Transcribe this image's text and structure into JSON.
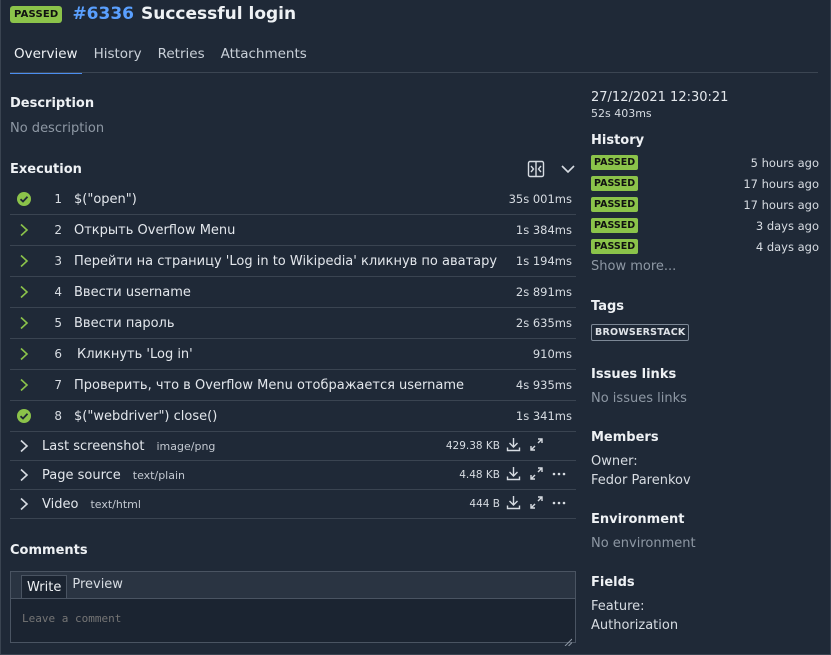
{
  "header": {
    "status": "PASSED",
    "test_number": "#6336",
    "title": "Successful login"
  },
  "tabs": [
    {
      "label": "Overview",
      "active": true
    },
    {
      "label": "History"
    },
    {
      "label": "Retries"
    },
    {
      "label": "Attachments"
    }
  ],
  "description": {
    "title": "Description",
    "value": "No description"
  },
  "execution": {
    "title": "Execution",
    "steps": [
      {
        "status": "passed",
        "num": "1",
        "name": "$(\"open\")",
        "duration": "35s 001ms"
      },
      {
        "status": "expand",
        "num": "2",
        "name": "Открыть Overflow Menu",
        "duration": "1s 384ms"
      },
      {
        "status": "expand",
        "num": "3",
        "name": "Перейти на страницу 'Log in to Wikipedia' кликнув по аватару",
        "duration": "1s 194ms"
      },
      {
        "status": "expand",
        "num": "4",
        "name": "Ввести username",
        "duration": "2s 891ms"
      },
      {
        "status": "expand",
        "num": "5",
        "name": "Ввести пароль",
        "duration": "2s 635ms"
      },
      {
        "status": "expand",
        "num": "6",
        "name": "Кликнуть 'Log in'",
        "duration": "910ms"
      },
      {
        "status": "expand",
        "num": "7",
        "name": "Проверить, что в Overflow Menu отображается username",
        "duration": "4s 935ms"
      },
      {
        "status": "passed",
        "num": "8",
        "name": "$(\"webdriver\") close()",
        "duration": "1s 341ms"
      }
    ],
    "attachments": [
      {
        "name": "Last screenshot",
        "type": "image/png",
        "size": "429.38 KB",
        "has_menu": false
      },
      {
        "name": "Page source",
        "type": "text/plain",
        "size": "4.48 KB",
        "has_menu": true
      },
      {
        "name": "Video",
        "type": "text/html",
        "size": "444 B",
        "has_menu": true
      }
    ]
  },
  "comments": {
    "title": "Comments",
    "write_tab": "Write",
    "preview_tab": "Preview",
    "placeholder": "Leave a comment"
  },
  "sidebar": {
    "datetime": "27/12/2021 12:30:21",
    "duration": "52s 403ms",
    "history_title": "History",
    "history": [
      {
        "status": "PASSED",
        "time": "5 hours ago"
      },
      {
        "status": "PASSED",
        "time": "17 hours ago"
      },
      {
        "status": "PASSED",
        "time": "17 hours ago"
      },
      {
        "status": "PASSED",
        "time": "3 days ago"
      },
      {
        "status": "PASSED",
        "time": "4 days ago"
      }
    ],
    "show_more": "Show more...",
    "tags_title": "Tags",
    "tag": "BROWSERSTACK",
    "issues_title": "Issues links",
    "issues_value": "No issues links",
    "members_title": "Members",
    "owner_label": "Owner:",
    "owner_name": "Fedor Parenkov",
    "environment_title": "Environment",
    "environment_value": "No environment",
    "fields_title": "Fields",
    "feature_label": "Feature:",
    "feature_value": "Authorization"
  },
  "colors": {
    "passed": "#8bc34a",
    "accent": "#4b8ef0",
    "background": "#1f2937"
  }
}
